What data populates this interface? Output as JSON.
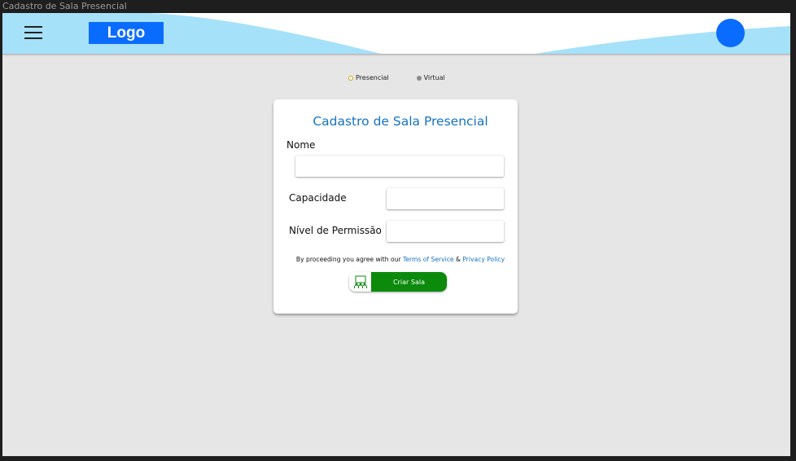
{
  "window": {
    "title": "Cadastro de Sala Presencial"
  },
  "header": {
    "logo_text": "Logo",
    "menu_icon": "hamburger-menu-icon",
    "avatar_icon": "user-avatar",
    "colors": {
      "wave": "#a6e1fa",
      "logo_bg": "#0a6cff",
      "avatar": "#0a6cff"
    }
  },
  "mode_selector": {
    "options": [
      {
        "label": "Presencial",
        "selected": true
      },
      {
        "label": "Virtual",
        "selected": false
      }
    ]
  },
  "form": {
    "title": "Cadastro de Sala Presencial",
    "fields": {
      "nome": {
        "label": "Nome",
        "value": ""
      },
      "capacidade": {
        "label": "Capacidade",
        "value": ""
      },
      "permissao": {
        "label": "Nível de Permissão",
        "value": ""
      }
    },
    "terms": {
      "prefix": "By proceeding you agree with our ",
      "terms_link": "Terms of Service",
      "joiner": " & ",
      "privacy_link": "Privacy Policy"
    },
    "submit": {
      "label": "Criar Sala",
      "icon": "classroom-icon",
      "color": "#0b8a0b"
    }
  }
}
